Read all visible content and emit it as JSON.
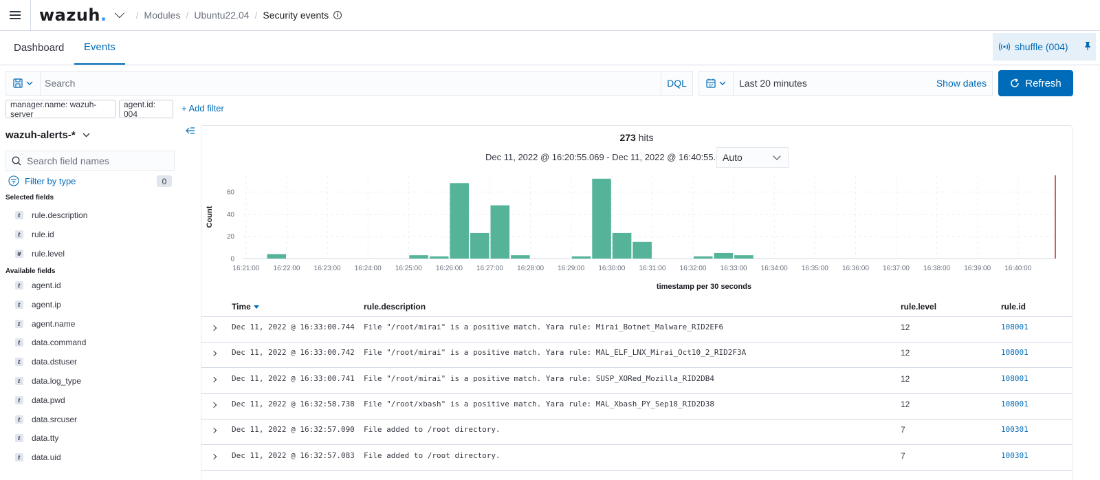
{
  "header": {
    "logo_text": "wazuh",
    "logo_dot": ".",
    "breadcrumbs": [
      "Modules",
      "Ubuntu22.04",
      "Security events"
    ],
    "breadcrumb_sep": "/",
    "info_glyph": "i"
  },
  "tabs": [
    {
      "label": "Dashboard",
      "active": false
    },
    {
      "label": "Events",
      "active": true
    }
  ],
  "agent_pill": {
    "label": "shuffle (004)"
  },
  "search": {
    "placeholder": "Search",
    "language": "DQL"
  },
  "date_picker": {
    "range": "Last 20 minutes",
    "show_dates": "Show dates"
  },
  "refresh_label": "Refresh",
  "filters": [
    "manager.name: wazuh-server",
    "agent.id: 004"
  ],
  "add_filter_label": "+ Add filter",
  "sidebar": {
    "index_pattern": "wazuh-alerts-*",
    "search_placeholder": "Search field names",
    "filter_by_type": "Filter by type",
    "filter_count": "0",
    "selected_title": "Selected fields",
    "selected_fields": [
      {
        "name": "rule.description",
        "type": "t"
      },
      {
        "name": "rule.id",
        "type": "t"
      },
      {
        "name": "rule.level",
        "type": "#"
      }
    ],
    "available_title": "Available fields",
    "available_fields": [
      {
        "name": "agent.id",
        "type": "t"
      },
      {
        "name": "agent.ip",
        "type": "t"
      },
      {
        "name": "agent.name",
        "type": "t"
      },
      {
        "name": "data.command",
        "type": "t"
      },
      {
        "name": "data.dstuser",
        "type": "t"
      },
      {
        "name": "data.log_type",
        "type": "t"
      },
      {
        "name": "data.pwd",
        "type": "t"
      },
      {
        "name": "data.srcuser",
        "type": "t"
      },
      {
        "name": "data.tty",
        "type": "t"
      },
      {
        "name": "data.uid",
        "type": "t"
      }
    ]
  },
  "hits": {
    "count": "273",
    "label": "hits"
  },
  "time_range_text": "Dec 11, 2022 @ 16:20:55.069 - Dec 11, 2022 @ 16:40:55.069",
  "interval": "Auto",
  "chart_data": {
    "type": "bar",
    "xlabel": "timestamp per 30 seconds",
    "ylabel": "Count",
    "ylim": [
      0,
      75
    ],
    "yticks": [
      0,
      20,
      40,
      60
    ],
    "xticks": [
      "16:21:00",
      "16:22:00",
      "16:23:00",
      "16:24:00",
      "16:25:00",
      "16:26:00",
      "16:27:00",
      "16:28:00",
      "16:29:00",
      "16:30:00",
      "16:31:00",
      "16:32:00",
      "16:33:00",
      "16:34:00",
      "16:35:00",
      "16:36:00",
      "16:37:00",
      "16:38:00",
      "16:39:00",
      "16:40:00"
    ],
    "bars": [
      {
        "x": "16:21:30",
        "value": 4
      },
      {
        "x": "16:25:00",
        "value": 3
      },
      {
        "x": "16:25:30",
        "value": 2
      },
      {
        "x": "16:26:00",
        "value": 68
      },
      {
        "x": "16:26:30",
        "value": 23
      },
      {
        "x": "16:27:00",
        "value": 48
      },
      {
        "x": "16:27:30",
        "value": 3
      },
      {
        "x": "16:29:00",
        "value": 2
      },
      {
        "x": "16:29:30",
        "value": 72
      },
      {
        "x": "16:30:00",
        "value": 23
      },
      {
        "x": "16:30:30",
        "value": 15
      },
      {
        "x": "16:32:00",
        "value": 2
      },
      {
        "x": "16:32:30",
        "value": 5
      },
      {
        "x": "16:33:00",
        "value": 3
      }
    ],
    "bar_color": "#54b399",
    "now_marker_color": "#bd271e",
    "grid": true
  },
  "table": {
    "columns": [
      "Time",
      "rule.description",
      "rule.level",
      "rule.id"
    ],
    "rows": [
      {
        "time": "Dec 11, 2022 @ 16:33:00.744",
        "description": "File \"/root/mirai\" is a positive match. Yara rule: Mirai_Botnet_Malware_RID2EF6",
        "level": "12",
        "id": "108001"
      },
      {
        "time": "Dec 11, 2022 @ 16:33:00.742",
        "description": "File \"/root/mirai\" is a positive match. Yara rule: MAL_ELF_LNX_Mirai_Oct10_2_RID2F3A",
        "level": "12",
        "id": "108001"
      },
      {
        "time": "Dec 11, 2022 @ 16:33:00.741",
        "description": "File \"/root/mirai\" is a positive match. Yara rule: SUSP_XORed_Mozilla_RID2DB4",
        "level": "12",
        "id": "108001"
      },
      {
        "time": "Dec 11, 2022 @ 16:32:58.738",
        "description": "File \"/root/xbash\" is a positive match. Yara rule: MAL_Xbash_PY_Sep18_RID2D38",
        "level": "12",
        "id": "108001"
      },
      {
        "time": "Dec 11, 2022 @ 16:32:57.090",
        "description": "File added to /root directory.",
        "level": "7",
        "id": "100301"
      },
      {
        "time": "Dec 11, 2022 @ 16:32:57.083",
        "description": "File added to /root directory.",
        "level": "7",
        "id": "100301"
      }
    ]
  },
  "colors": {
    "accent": "#006bb8",
    "text": "#343741",
    "border": "#d3dae6"
  }
}
